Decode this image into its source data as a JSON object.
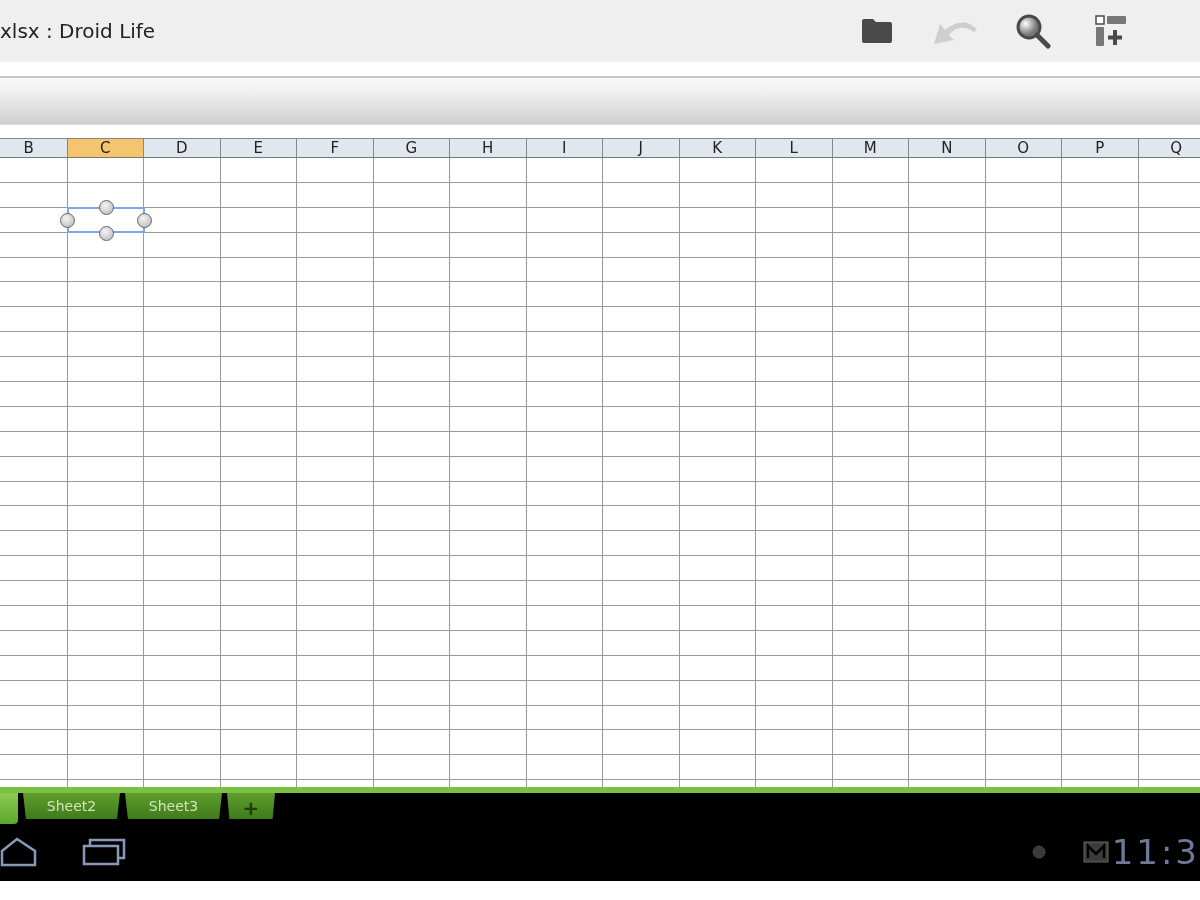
{
  "action_bar": {
    "title": "xlsx : Droid Life",
    "actions": [
      {
        "kind": "folder",
        "disabled": false
      },
      {
        "kind": "undo",
        "disabled": true
      },
      {
        "kind": "search",
        "disabled": false
      },
      {
        "kind": "insert",
        "disabled": false
      }
    ]
  },
  "grid": {
    "columns": [
      {
        "label": "B",
        "selected": false
      },
      {
        "label": "C",
        "selected": true
      },
      {
        "label": "D",
        "selected": false
      },
      {
        "label": "E",
        "selected": false
      },
      {
        "label": "F",
        "selected": false
      },
      {
        "label": "G",
        "selected": false
      },
      {
        "label": "H",
        "selected": false
      },
      {
        "label": "I",
        "selected": false
      },
      {
        "label": "J",
        "selected": false
      },
      {
        "label": "K",
        "selected": false
      },
      {
        "label": "L",
        "selected": false
      },
      {
        "label": "M",
        "selected": false
      },
      {
        "label": "N",
        "selected": false
      },
      {
        "label": "O",
        "selected": false
      },
      {
        "label": "P",
        "selected": false
      },
      {
        "label": "Q",
        "selected": false
      }
    ],
    "rows": [
      {
        "selected": false
      },
      {
        "selected": false
      },
      {
        "selected": true
      },
      {
        "selected": false
      },
      {
        "selected": false
      },
      {
        "selected": false
      },
      {
        "selected": false
      },
      {
        "selected": false
      },
      {
        "selected": false
      },
      {
        "selected": false
      },
      {
        "selected": false
      },
      {
        "selected": false
      },
      {
        "selected": false
      },
      {
        "selected": false
      },
      {
        "selected": false
      },
      {
        "selected": false
      },
      {
        "selected": false
      },
      {
        "selected": false
      },
      {
        "selected": false
      },
      {
        "selected": false
      },
      {
        "selected": false
      },
      {
        "selected": false
      },
      {
        "selected": false
      },
      {
        "selected": false
      },
      {
        "selected": false
      },
      {
        "selected": false
      }
    ]
  },
  "sheet_tabs": [
    {
      "selected": true
    },
    {
      "label": "Sheet2",
      "selected": false
    },
    {
      "label": "Sheet3",
      "selected": false
    }
  ],
  "add_sheet": "+",
  "system_bar": {
    "clock": "11:3"
  }
}
